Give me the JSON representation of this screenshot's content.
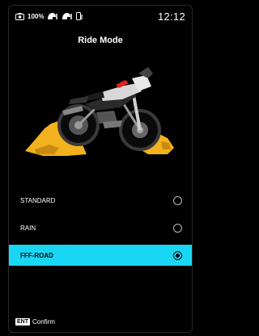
{
  "status_bar": {
    "battery_icon": "camera-battery-icon",
    "battery_level": "100%",
    "connection_icons": [
      "helmet-link-icon",
      "helmet-link-icon",
      "phone-link-icon"
    ],
    "time": "12:12"
  },
  "screen": {
    "title": "Ride Mode",
    "hero_image": "motorcycle-offroad-illustration",
    "accent_color": "#1ad6f5",
    "terrain_color": "#f2b21d"
  },
  "ride_modes": [
    {
      "label": "STANDARD",
      "selected": false
    },
    {
      "label": "RAIN",
      "selected": false
    },
    {
      "label": "FFF-ROAD",
      "selected": true
    }
  ],
  "footer": {
    "key": "ENT",
    "action": "Confirm"
  }
}
